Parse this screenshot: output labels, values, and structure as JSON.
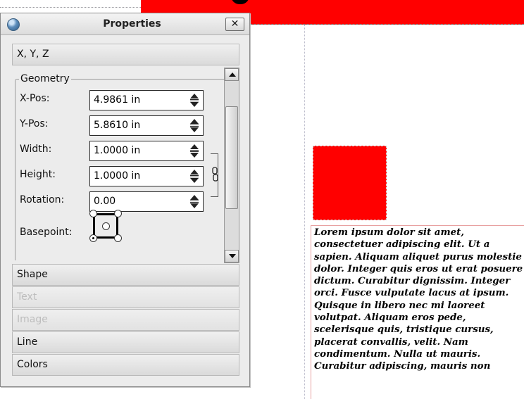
{
  "window": {
    "title": "Properties",
    "close_label": "✕"
  },
  "sections": {
    "xyz": "X, Y, Z",
    "shape": "Shape",
    "text": "Text",
    "image": "Image",
    "line": "Line",
    "colors": "Colors"
  },
  "geometry": {
    "legend": "Geometry",
    "xpos_label": "X-Pos:",
    "xpos_value": "4.9861 in",
    "ypos_label": "Y-Pos:",
    "ypos_value": "5.8610 in",
    "width_label": "Width:",
    "width_value": "1.0000 in",
    "height_label": "Height:",
    "height_value": "1.0000 in",
    "rotation_label": "Rotation:",
    "rotation_value": "0.00",
    "basepoint_label": "Basepoint:"
  },
  "document": {
    "lorem_text": "Lorem ipsum dolor sit amet, consectetuer adipiscing elit. Ut a sapien. Aliquam aliquet purus molestie dolor. Integer quis eros ut erat posuere dictum. Curabitur dignissim. Integer orci. Fusce vulputate lacus at ipsum. Quisque in libero nec mi laoreet volutpat. Aliquam eros pede, scelerisque quis, tristique cursus, placerat convallis, velit. Nam condimentum. Nulla ut mauris. Curabitur adipiscing, mauris non"
  },
  "colors": {
    "shape_fill": "#ff0000",
    "text_frame_border": "#e8a0a0"
  }
}
